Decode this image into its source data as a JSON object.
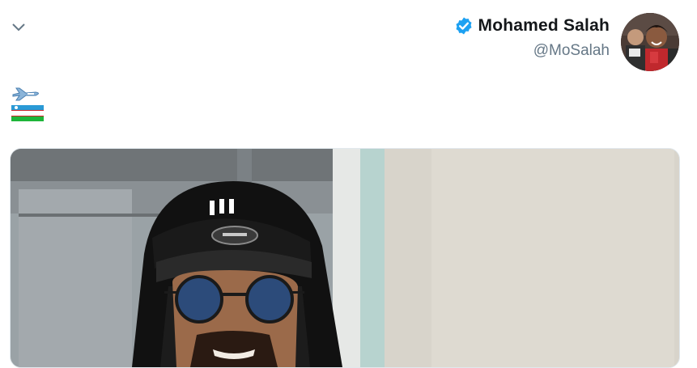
{
  "tweet": {
    "author": {
      "display_name": "Mohamed Salah",
      "handle": "@MoSalah",
      "verified": true,
      "verified_icon": "verified-badge-icon",
      "avatar_icon": "profile-avatar"
    },
    "menu_icon": "chevron-down-icon",
    "text_emojis": [
      "airplane-emoji",
      "flag-uzbekistan-emoji"
    ],
    "media": {
      "type": "photo",
      "description_icon": "photo-of-man-in-black-hood-cap-and-round-sunglasses"
    }
  },
  "colors": {
    "accent": "#1da1f2",
    "name": "#14171a",
    "handle": "#657786",
    "border": "#e1e8ed"
  }
}
